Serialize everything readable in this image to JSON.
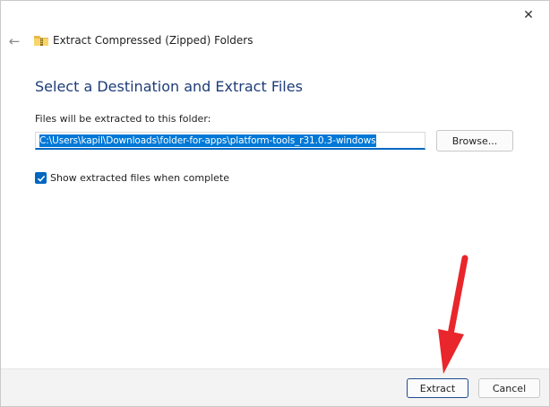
{
  "window": {
    "title": "Extract Compressed (Zipped) Folders",
    "close_glyph": "✕",
    "back_glyph": "←"
  },
  "main": {
    "heading": "Select a Destination and Extract Files",
    "destination_label": "Files will be extracted to this folder:",
    "destination_path": "C:\\Users\\kapil\\Downloads\\folder-for-apps\\platform-tools_r31.0.3-windows",
    "browse_label": "Browse...",
    "show_files_label": "Show extracted files when complete",
    "show_files_checked": true
  },
  "footer": {
    "extract_label": "Extract",
    "cancel_label": "Cancel"
  },
  "colors": {
    "heading": "#1e3c78",
    "accent": "#0067c0",
    "annotation_arrow": "#e8262b"
  },
  "icons": {
    "back": "arrow-left-icon",
    "close": "close-icon",
    "folder": "zip-folder-icon",
    "checkbox": "checkmark-icon",
    "annotation": "red-arrow-annotation"
  }
}
